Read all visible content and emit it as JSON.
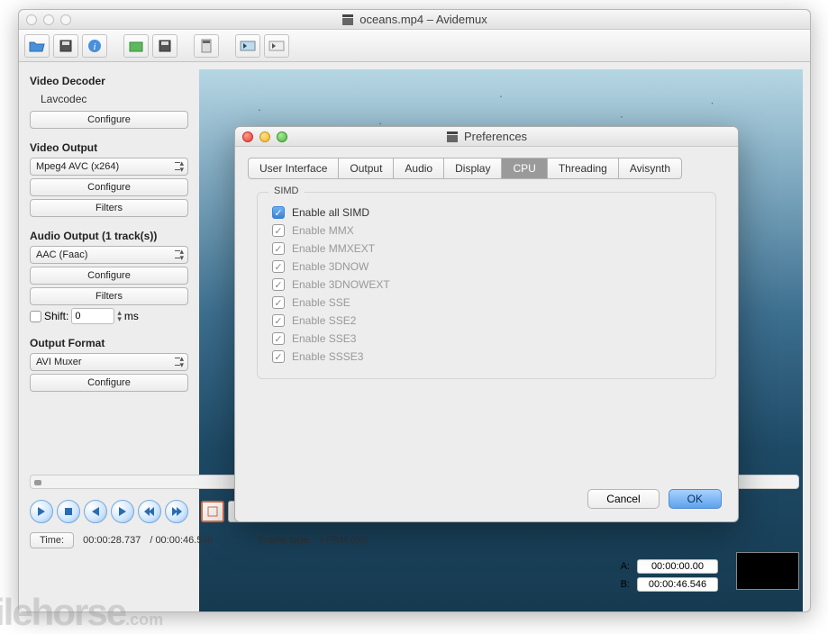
{
  "window": {
    "title": "oceans.mp4 – Avidemux"
  },
  "sidebar": {
    "video_decoder": {
      "title": "Video Decoder",
      "codec": "Lavcodec",
      "configure": "Configure"
    },
    "video_output": {
      "title": "Video Output",
      "selected": "Mpeg4 AVC (x264)",
      "configure": "Configure",
      "filters": "Filters"
    },
    "audio_output": {
      "title": "Audio Output (1 track(s))",
      "selected": "AAC (Faac)",
      "configure": "Configure",
      "filters": "Filters",
      "shift_label": "Shift:",
      "shift_value": "0",
      "shift_unit": "ms"
    },
    "output_format": {
      "title": "Output Format",
      "selected": "AVI Muxer",
      "configure": "Configure"
    }
  },
  "status": {
    "time_label": "Time:",
    "time_current": "00:00:28.737",
    "time_total": "/ 00:00:46.546",
    "frame_type_label": "Frame type:",
    "frame_type_value": "I-FRM (00)",
    "a_label": "A:",
    "a_value": "00:00:00.00",
    "b_label": "B:",
    "b_value": "00:00:46.546"
  },
  "dialog": {
    "title": "Preferences",
    "tabs": [
      "User Interface",
      "Output",
      "Audio",
      "Display",
      "CPU",
      "Threading",
      "Avisynth"
    ],
    "active_tab": "CPU",
    "group_title": "SIMD",
    "checks": [
      {
        "label": "Enable all SIMD",
        "checked": true,
        "enabled": true
      },
      {
        "label": "Enable MMX",
        "checked": true,
        "enabled": false
      },
      {
        "label": "Enable MMXEXT",
        "checked": true,
        "enabled": false
      },
      {
        "label": "Enable 3DNOW",
        "checked": true,
        "enabled": false
      },
      {
        "label": "Enable 3DNOWEXT",
        "checked": true,
        "enabled": false
      },
      {
        "label": "Enable SSE",
        "checked": true,
        "enabled": false
      },
      {
        "label": "Enable SSE2",
        "checked": true,
        "enabled": false
      },
      {
        "label": "Enable SSE3",
        "checked": true,
        "enabled": false
      },
      {
        "label": "Enable SSSE3",
        "checked": true,
        "enabled": false
      }
    ],
    "cancel": "Cancel",
    "ok": "OK"
  },
  "watermark": "filehorse",
  "watermark_suffix": ".com"
}
